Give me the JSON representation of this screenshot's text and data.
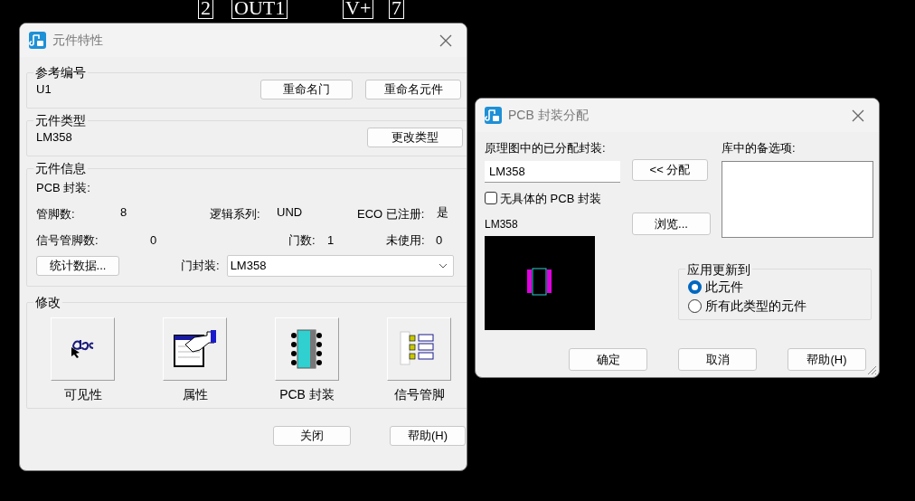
{
  "schematic": {
    "labels": [
      "2",
      "OUT1",
      "V+",
      "7"
    ]
  },
  "part_dialog": {
    "title": "元件特性",
    "reference": {
      "legend": "参考编号",
      "value": "U1",
      "buttons": [
        "重命名门",
        "重命名元件"
      ]
    },
    "part_type": {
      "legend": "元件类型",
      "value": "LM358",
      "button": "更改类型"
    },
    "part_info": {
      "legend": "元件信息",
      "pcb_decal_label": "PCB 封装:",
      "rows": [
        [
          {
            "label": "管脚数:",
            "value": "8"
          },
          {
            "label": "逻辑系列:",
            "value": "UND"
          },
          {
            "label": "ECO 已注册:",
            "value": "是"
          }
        ],
        [
          {
            "label": "信号管脚数:",
            "value": "0"
          },
          {
            "label": "门数:",
            "value": "1"
          },
          {
            "label": "未使用:",
            "value": "0"
          }
        ]
      ],
      "stats_button": "统计数据...",
      "gate_decal_label": "门封装:",
      "gate_decal_value": "LM358"
    },
    "modify": {
      "legend": "修改",
      "items": [
        {
          "kind": "visibility",
          "label": "可见性"
        },
        {
          "kind": "attributes",
          "label": "属性"
        },
        {
          "kind": "decal",
          "label": "PCB 封装"
        },
        {
          "kind": "signal_pins",
          "label": "信号管脚"
        }
      ]
    },
    "buttons": [
      "关闭",
      "帮助(H)"
    ]
  },
  "decal_dialog": {
    "title": "PCB 封装分配",
    "assigned_label": "原理图中的已分配封装:",
    "assigned_value": "LM358",
    "assign_button": "<< 分配",
    "library_label": "库中的备选项:",
    "no_decal": {
      "label": "无具体的 PCB 封装",
      "checked": false
    },
    "preview_label": "LM358",
    "browse_button": "浏览...",
    "update": {
      "legend": "应用更新到",
      "options": [
        {
          "label": "此元件",
          "selected": true
        },
        {
          "label": "所有此类型的元件",
          "selected": false
        }
      ]
    },
    "buttons": [
      "确定",
      "取消",
      "帮助(H)"
    ]
  }
}
